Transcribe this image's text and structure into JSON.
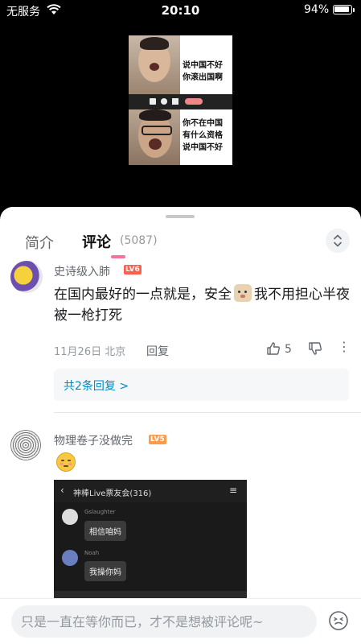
{
  "status": {
    "carrier": "无服务",
    "time": "20:10",
    "battery": "94%",
    "battery_level": 0.94
  },
  "video": {
    "caption_top": [
      "说中国不好",
      "你滚出国啊"
    ],
    "caption_bottom": [
      "你不在中国",
      "有什么资格",
      "说中国不好"
    ]
  },
  "tabs": {
    "intro": "简介",
    "comments": "评论",
    "count": "(5087)"
  },
  "comments": [
    {
      "user": "史诗级入肺",
      "level": "LV6",
      "text_a": "在国内最好的一点就是，安全",
      "text_b": "我不用担心半夜被一枪打死",
      "date": "11月26日 北京",
      "reply": "回复",
      "likes": "5",
      "replies_label": "共2条回复 >"
    },
    {
      "user": "物理卷子没做完",
      "level": "LV5",
      "image": {
        "header": "神棒Live票友会(316)",
        "msg1_user": "Gslaughter",
        "msg1": "相信咱妈",
        "msg2_user": "Noah",
        "msg2": "我操你妈"
      }
    }
  ],
  "input": {
    "placeholder": "只是一直在等你而已，才不是想被评论呢~"
  },
  "colors": {
    "accent": "#fb7299",
    "link": "#008ac5"
  }
}
